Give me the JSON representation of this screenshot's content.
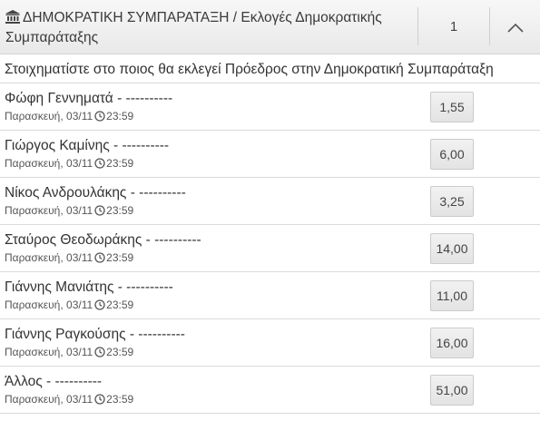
{
  "header": {
    "title": "ΔΗΜΟΚΡΑΤΙΚΗ ΣΥΜΠΑΡΑΤΑΞΗ / Εκλογές Δημοκρατικής Συμπαράταξης",
    "count": "1",
    "icon": "bank-icon",
    "collapse_icon": "chevron-up-icon"
  },
  "question": "Στοιχηματίστε στο ποιος θα εκλεγεί Πρόεδρος στην Δημοκρατική Συμπαράταξη",
  "selections": [
    {
      "name": "Φώφη Γεννηματά - ----------",
      "day": "Παρασκευή, 03/11",
      "time": "23:59",
      "odds": "1,55"
    },
    {
      "name": "Γιώργος Καμίνης - ----------",
      "day": "Παρασκευή, 03/11",
      "time": "23:59",
      "odds": "6,00"
    },
    {
      "name": "Νίκος Ανδρουλάκης - ----------",
      "day": "Παρασκευή, 03/11",
      "time": "23:59",
      "odds": "3,25"
    },
    {
      "name": "Σταύρος Θεοδωράκης - ----------",
      "day": "Παρασκευή, 03/11",
      "time": "23:59",
      "odds": "14,00"
    },
    {
      "name": "Γιάννης Μανιάτης - ----------",
      "day": "Παρασκευή, 03/11",
      "time": "23:59",
      "odds": "11,00"
    },
    {
      "name": "Γιάννης Ραγκούσης - ----------",
      "day": "Παρασκευή, 03/11",
      "time": "23:59",
      "odds": "16,00"
    },
    {
      "name": "Άλλος - ----------",
      "day": "Παρασκευή, 03/11",
      "time": "23:59",
      "odds": "51,00"
    }
  ]
}
